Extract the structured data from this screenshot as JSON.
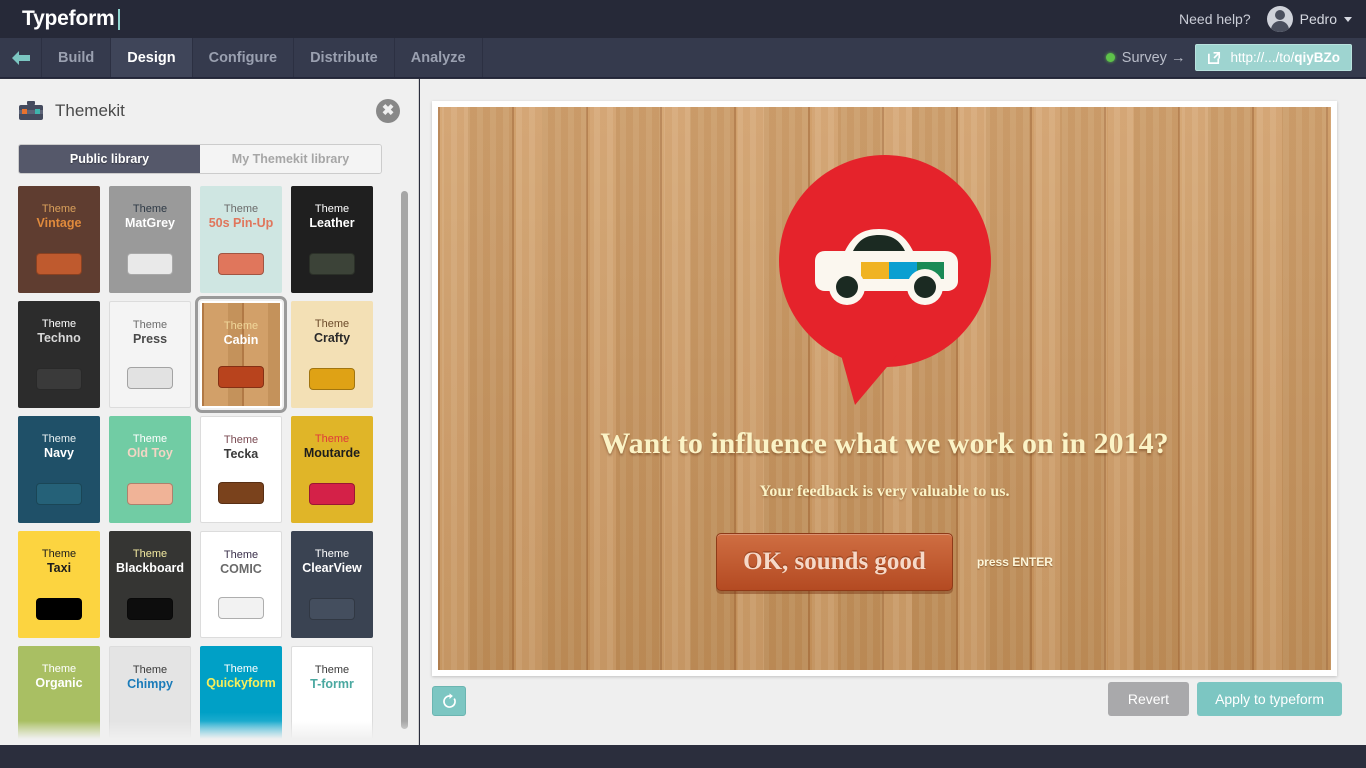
{
  "topbar": {
    "brand": "Typeform",
    "need_help": "Need help?",
    "user_name": "Pedro",
    "avatar_icon": "user-avatar-icon",
    "caret_icon": "chevron-down-icon"
  },
  "nav": {
    "back_icon": "back-arrow-icon",
    "tabs": [
      {
        "label": "Build",
        "active": false
      },
      {
        "label": "Design",
        "active": true
      },
      {
        "label": "Configure",
        "active": false
      },
      {
        "label": "Distribute",
        "active": false
      },
      {
        "label": "Analyze",
        "active": false
      }
    ],
    "survey_label": "Survey →",
    "status_dot_color": "#5ec24a",
    "url_icon": "external-link-icon",
    "url_prefix": "http://.../to/",
    "url_slug": "qiyBZo"
  },
  "panel": {
    "icon": "toolbox-icon",
    "title": "Themekit",
    "close_icon": "close-icon",
    "tabs": [
      {
        "label": "Public library",
        "active": true
      },
      {
        "label": "My Themekit library",
        "active": false
      }
    ],
    "theme_word": "Theme",
    "themes": [
      {
        "name": "Vintage",
        "bg": "#5f3d30",
        "word_color": "#d9a05b",
        "name_color": "#e08a3c",
        "btn": "#bf5a2e",
        "selected": false
      },
      {
        "name": "MatGrey",
        "bg": "#9a9a9a",
        "word_color": "#2f3a46",
        "name_color": "#ffffff",
        "btn": "#e9e9e9",
        "selected": false
      },
      {
        "name": "50s Pin-Up",
        "bg": "#cfe6e2",
        "word_color": "#6b6b6b",
        "name_color": "#e0765c",
        "btn": "#e0765c",
        "selected": false
      },
      {
        "name": "Leather",
        "bg": "#1f1f1f",
        "word_color": "#ffffff",
        "name_color": "#ffffff",
        "btn": "#3c4338",
        "selected": false
      },
      {
        "name": "Techno",
        "bg": "#2c2c2c",
        "word_color": "#ffffff",
        "name_color": "#d8d8d8",
        "btn": "#3a3a3a",
        "selected": false
      },
      {
        "name": "Press",
        "bg": "#f4f4f4",
        "word_color": "#6b6b6b",
        "name_color": "#4a4a4a",
        "btn": "#e2e2e2",
        "selected": false
      },
      {
        "name": "Cabin",
        "bg": "#cf9a60",
        "word_color": "#f0d79a",
        "name_color": "#ffffff",
        "btn": "#b8431d",
        "selected": true
      },
      {
        "name": "Crafty",
        "bg": "#f3e0b5",
        "word_color": "#6b4a2a",
        "name_color": "#2a2a2a",
        "btn": "#dfa215",
        "selected": false
      },
      {
        "name": "Navy",
        "bg": "#1f5068",
        "word_color": "#e8f0f2",
        "name_color": "#ffffff",
        "btn": "#256178",
        "selected": false
      },
      {
        "name": "Old Toy",
        "bg": "#71cca4",
        "word_color": "#ffffff",
        "name_color": "#f3d5c4",
        "btn": "#f0b397",
        "selected": false
      },
      {
        "name": "Tecka",
        "bg": "#ffffff",
        "word_color": "#7a4a52",
        "name_color": "#3a3a3a",
        "btn": "#7a421c",
        "selected": false
      },
      {
        "name": "Moutarde",
        "bg": "#e0b528",
        "word_color": "#e03a3a",
        "name_color": "#1d1d1d",
        "btn": "#d42148",
        "selected": false
      },
      {
        "name": "Taxi",
        "bg": "#fcd440",
        "word_color": "#1d1d1d",
        "name_color": "#1d1d1d",
        "btn": "#000000",
        "selected": false
      },
      {
        "name": "Blackboard",
        "bg": "#353533",
        "word_color": "#f2e9a0",
        "name_color": "#ffffff",
        "btn": "#0d0d0d",
        "selected": false
      },
      {
        "name": "COMIC",
        "bg": "#ffffff",
        "word_color": "#3a2f4a",
        "name_color": "#6a6a6a",
        "btn": "#f2f2f2",
        "selected": false
      },
      {
        "name": "ClearView",
        "bg": "#3a4352",
        "word_color": "#ffffff",
        "name_color": "#ffffff",
        "btn": "#444e5e",
        "selected": false
      },
      {
        "name": "Organic",
        "bg": "#a9bf63",
        "word_color": "#ffffff",
        "name_color": "#ffffff",
        "btn": "",
        "selected": false
      },
      {
        "name": "Chimpy",
        "bg": "#e4e4e4",
        "word_color": "#3a3a3a",
        "name_color": "#1a7bb9",
        "btn": "",
        "selected": false
      },
      {
        "name": "Quickyform",
        "bg": "#00a0c6",
        "word_color": "#ffffff",
        "name_color": "#f7ef5a",
        "btn": "",
        "selected": false
      },
      {
        "name": "T-formr",
        "bg": "#ffffff",
        "word_color": "#3a3a3a",
        "name_color": "#4aa8a0",
        "btn": "",
        "selected": false
      }
    ]
  },
  "preview": {
    "logo_icon": "car-speech-bubble-logo",
    "headline": "Want to influence what we work on in 2014?",
    "subline": "Your feedback is very valuable to us.",
    "cta_label": "OK, sounds good",
    "press_enter": "press ENTER",
    "refresh_icon": "refresh-icon",
    "revert_label": "Revert",
    "apply_label": "Apply to typeform"
  }
}
